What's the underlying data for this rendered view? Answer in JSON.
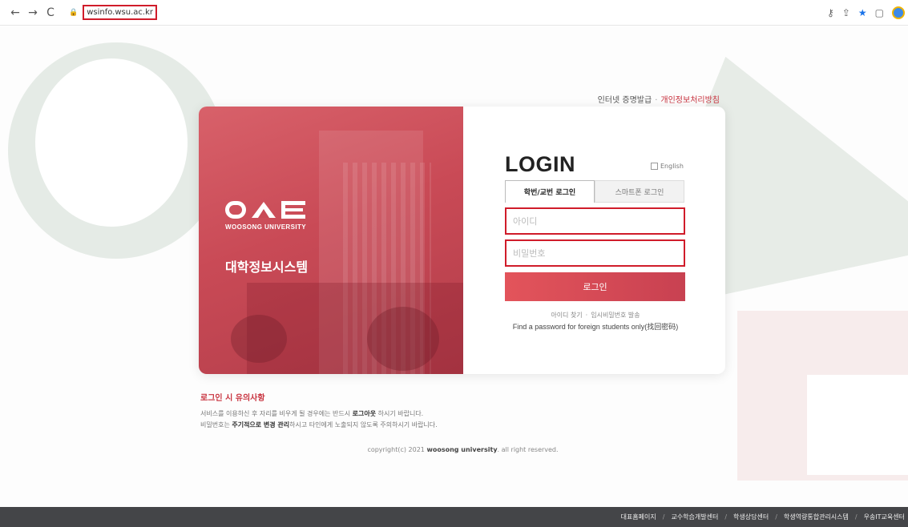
{
  "browser": {
    "back_icon": "←",
    "forward_icon": "→",
    "reload_icon": "C",
    "lock_icon": "🔒",
    "url": "wsinfo.wsu.ac.kr",
    "key_icon": "⚷",
    "share_icon": "⇪",
    "star_icon": "★",
    "panel_icon": "▢"
  },
  "top_links": {
    "certificate": "인터넷 증명발급",
    "separator": "·",
    "privacy": "개인정보처리방침"
  },
  "brand": {
    "university": "WOOSONG UNIVERSITY",
    "system_name": "대학정보시스템"
  },
  "login": {
    "title": "LOGIN",
    "english_label": "English",
    "tabs": [
      {
        "label": "학번/교번 로그인"
      },
      {
        "label": "스마트폰 로그인"
      }
    ],
    "id_placeholder": "아이디",
    "pw_placeholder": "비밀번호",
    "button_label": "로그인",
    "find_id": "아이디 찾기",
    "find_sep": "·",
    "temp_pw": "임시비밀번호 발송",
    "foreign": "Find a password for foreign students only(找回密码)"
  },
  "notice": {
    "title": "로그인 시 유의사항",
    "line1_a": "서비스를 이용하신 후 자리를 비우게 될 경우에는 반드시 ",
    "line1_b": "로그아웃",
    "line1_c": " 하시기 바랍니다.",
    "line2_a": "비밀번호는 ",
    "line2_b": "주기적으로 변경 관리",
    "line2_c": "하시고 타인에게 노출되지 않도록 주의하시기 바랍니다."
  },
  "copyright": {
    "prefix": "copyright(c) 2021 ",
    "bold": "woosong university",
    "suffix": ". all right reserved."
  },
  "footer": {
    "separator": "/",
    "links": [
      "대표홈페이지",
      "교수학습개발센터",
      "학생상담센터",
      "학생역량통합관리시스템",
      "우송IT교육센터"
    ]
  },
  "colors": {
    "accent": "#c8333f",
    "highlight_border": "#d01c2a",
    "footer_bg": "#444548"
  }
}
